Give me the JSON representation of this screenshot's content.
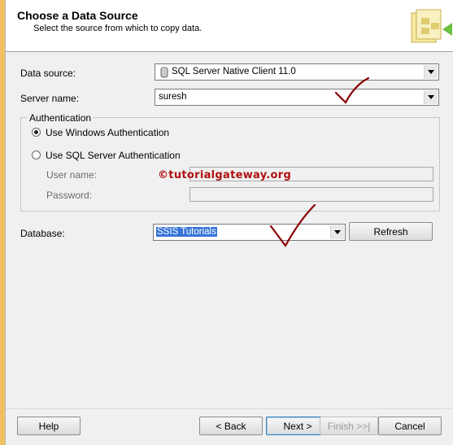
{
  "header": {
    "title": "Choose a Data Source",
    "subtitle": "Select the source from which to copy data."
  },
  "form": {
    "data_source_label": "Data source:",
    "data_source_value": "SQL Server Native Client 11.0",
    "server_name_label": "Server name:",
    "server_name_value": "suresh",
    "authentication_title": "Authentication",
    "windows_auth_label": "Use Windows Authentication",
    "sql_auth_label": "Use SQL Server Authentication",
    "auth_selected": "Use Windows Authentication",
    "user_name_label": "User name:",
    "password_label": "Password:",
    "database_label": "Database:",
    "database_value": "SSIS Tutorials",
    "refresh_label": "Refresh"
  },
  "watermark": "©tutorialgateway.org",
  "buttons": {
    "help": "Help",
    "back": "< Back",
    "next": "Next >",
    "finish": "Finish >>|",
    "cancel": "Cancel"
  },
  "annotations": {
    "check_color": "#8b0000"
  }
}
